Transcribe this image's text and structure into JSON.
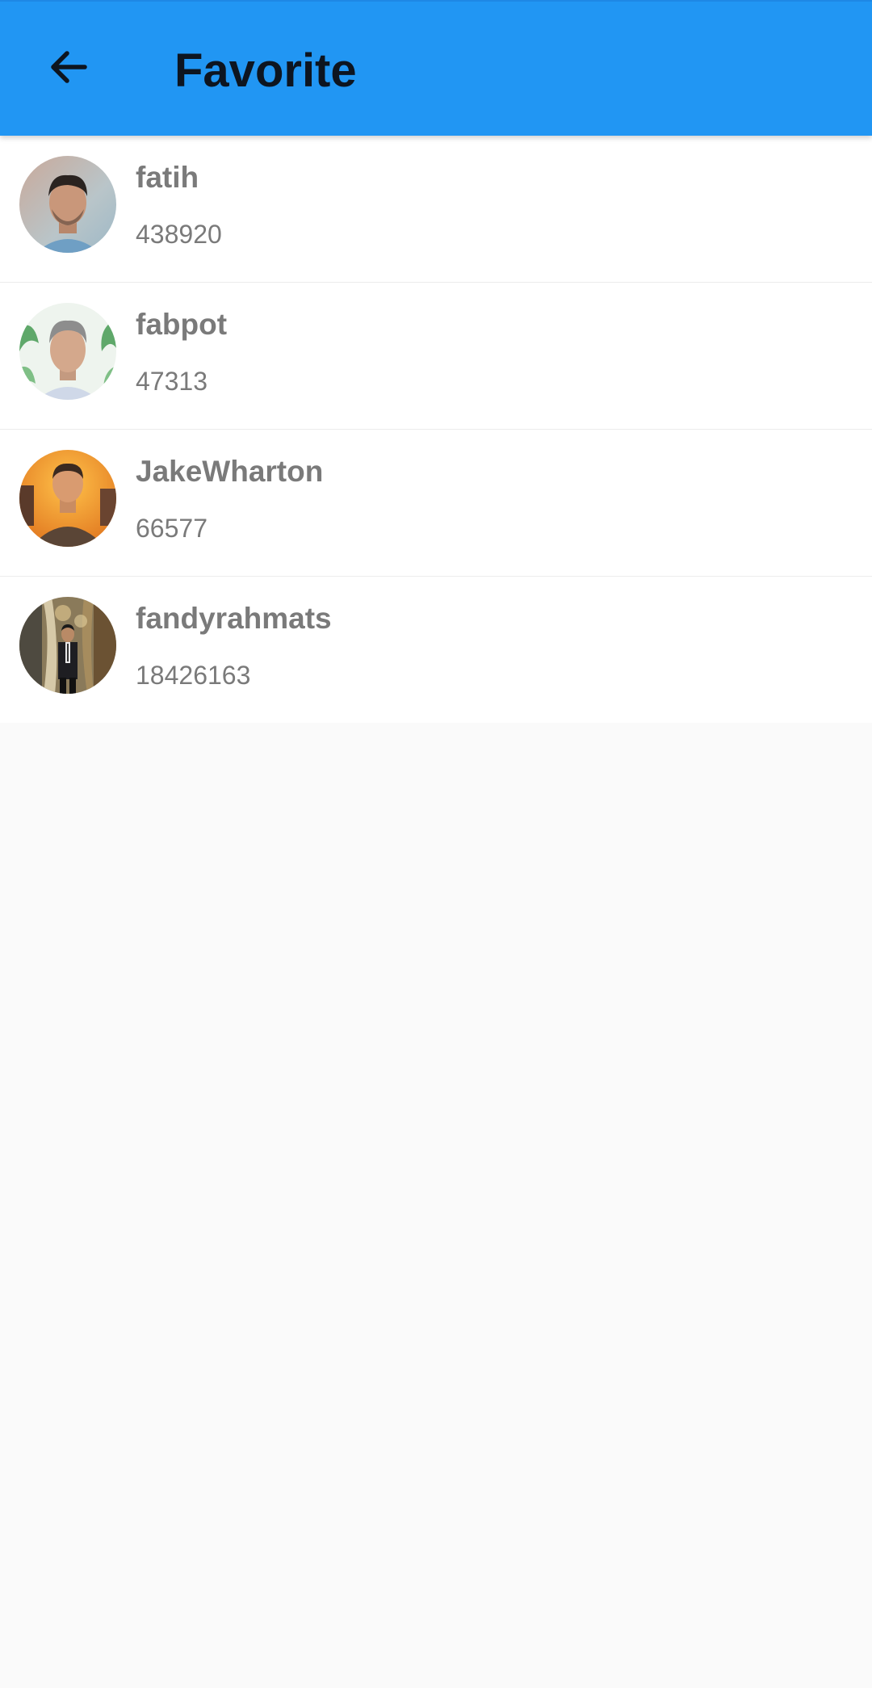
{
  "app_bar": {
    "title": "Favorite",
    "back_icon": "arrow-left-icon",
    "background_color": "#2196f3"
  },
  "favorites": [
    {
      "username": "fatih",
      "id": "438920",
      "avatar_icon": "avatar-photo"
    },
    {
      "username": "fabpot",
      "id": "47313",
      "avatar_icon": "avatar-photo"
    },
    {
      "username": "JakeWharton",
      "id": "66577",
      "avatar_icon": "avatar-photo"
    },
    {
      "username": "fandyrahmats",
      "id": "18426163",
      "avatar_icon": "avatar-photo"
    }
  ]
}
